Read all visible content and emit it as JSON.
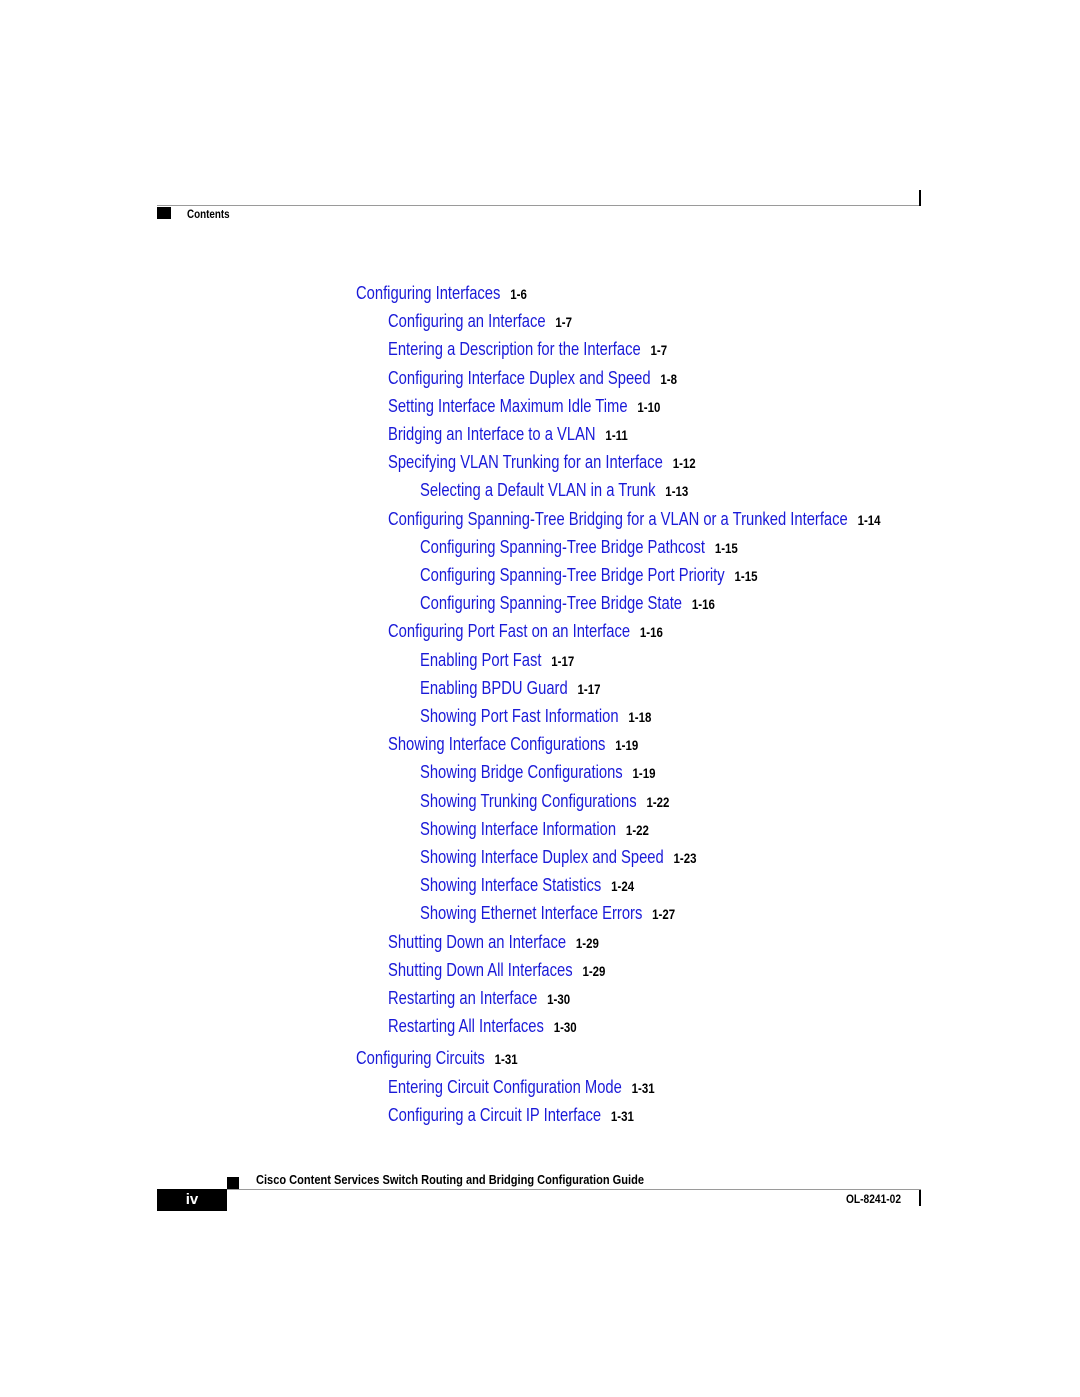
{
  "header": {
    "section_label": "Contents"
  },
  "toc": [
    {
      "level": 0,
      "title": "Configuring Interfaces",
      "page": "1-6"
    },
    {
      "level": 1,
      "title": "Configuring an Interface",
      "page": "1-7"
    },
    {
      "level": 1,
      "title": "Entering a Description for the Interface",
      "page": "1-7"
    },
    {
      "level": 1,
      "title": "Configuring Interface Duplex and Speed",
      "page": "1-8"
    },
    {
      "level": 1,
      "title": "Setting Interface Maximum Idle Time",
      "page": "1-10"
    },
    {
      "level": 1,
      "title": "Bridging an Interface to a VLAN",
      "page": "1-11"
    },
    {
      "level": 1,
      "title": "Specifying VLAN Trunking for an Interface",
      "page": "1-12"
    },
    {
      "level": 2,
      "title": "Selecting a Default VLAN in a Trunk",
      "page": "1-13"
    },
    {
      "level": 1,
      "title": "Configuring Spanning-Tree Bridging for a VLAN or a Trunked Interface",
      "page": "1-14"
    },
    {
      "level": 2,
      "title": "Configuring Spanning-Tree Bridge Pathcost",
      "page": "1-15"
    },
    {
      "level": 2,
      "title": "Configuring Spanning-Tree Bridge Port Priority",
      "page": "1-15"
    },
    {
      "level": 2,
      "title": "Configuring Spanning-Tree Bridge State",
      "page": "1-16"
    },
    {
      "level": 1,
      "title": "Configuring Port Fast on an Interface",
      "page": "1-16"
    },
    {
      "level": 2,
      "title": "Enabling Port Fast",
      "page": "1-17"
    },
    {
      "level": 2,
      "title": "Enabling BPDU Guard",
      "page": "1-17"
    },
    {
      "level": 2,
      "title": "Showing Port Fast Information",
      "page": "1-18"
    },
    {
      "level": 1,
      "title": "Showing Interface Configurations",
      "page": "1-19"
    },
    {
      "level": 2,
      "title": "Showing Bridge Configurations",
      "page": "1-19"
    },
    {
      "level": 2,
      "title": "Showing Trunking Configurations",
      "page": "1-22"
    },
    {
      "level": 2,
      "title": "Showing Interface Information",
      "page": "1-22"
    },
    {
      "level": 2,
      "title": "Showing Interface Duplex and Speed",
      "page": "1-23"
    },
    {
      "level": 2,
      "title": "Showing Interface Statistics",
      "page": "1-24"
    },
    {
      "level": 2,
      "title": "Showing Ethernet Interface Errors",
      "page": "1-27"
    },
    {
      "level": 1,
      "title": "Shutting Down an Interface",
      "page": "1-29"
    },
    {
      "level": 1,
      "title": "Shutting Down All Interfaces",
      "page": "1-29"
    },
    {
      "level": 1,
      "title": "Restarting an Interface",
      "page": "1-30"
    },
    {
      "level": 1,
      "title": "Restarting All Interfaces",
      "page": "1-30"
    },
    {
      "level": 0,
      "title": "Configuring Circuits",
      "page": "1-31"
    },
    {
      "level": 1,
      "title": "Entering Circuit Configuration Mode",
      "page": "1-31"
    },
    {
      "level": 1,
      "title": "Configuring a Circuit IP Interface",
      "page": "1-31"
    }
  ],
  "footer": {
    "book_title": "Cisco Content Services Switch Routing and Bridging Configuration Guide",
    "page_number": "iv",
    "doc_number": "OL-8241-02"
  }
}
